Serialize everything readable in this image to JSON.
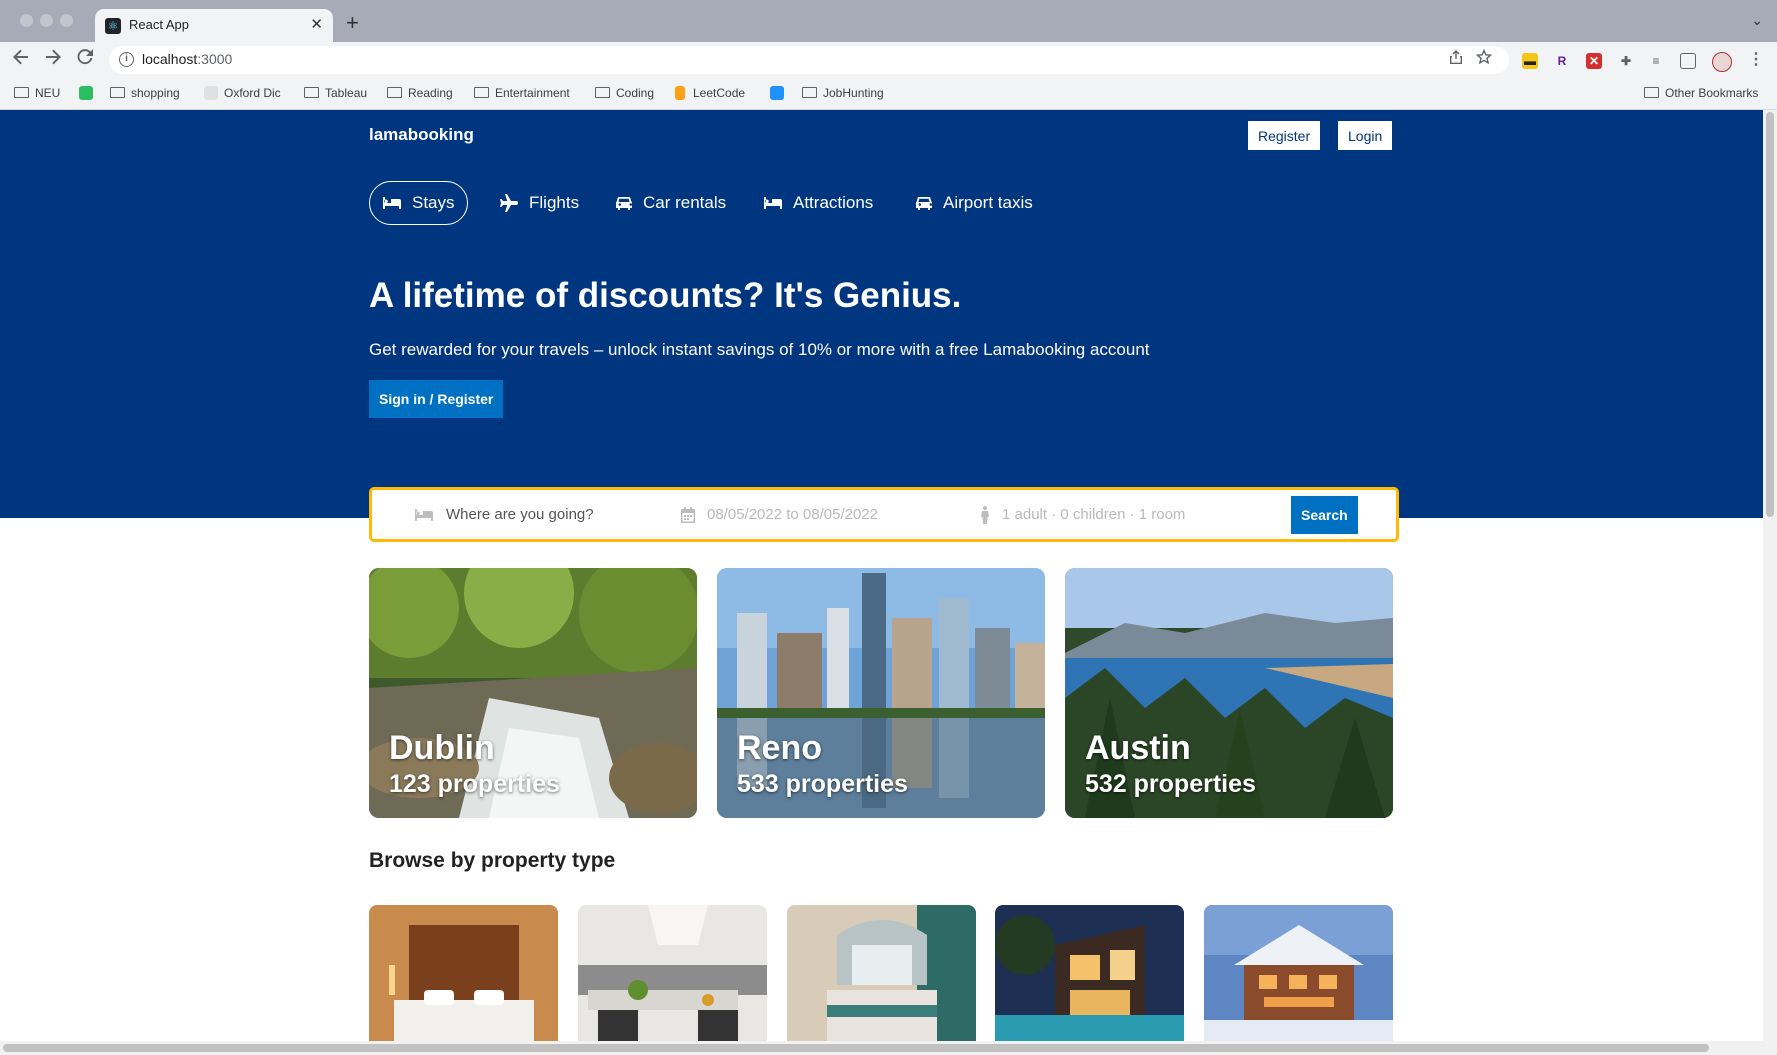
{
  "browser": {
    "tab_title": "React App",
    "tab_favicon": "⚛",
    "close_glyph": "✕",
    "newtab_glyph": "+",
    "menu_glyph": "⌄",
    "url_host": "localhost",
    "url_port": ":3000",
    "icons": [
      "back-icon",
      "forward-icon",
      "reload-icon",
      "info-icon",
      "share-icon",
      "star-icon",
      "extensions-icon",
      "reading-list-icon",
      "side-panel-icon",
      "profile-icon",
      "menu-icon"
    ],
    "bookmarks": [
      "NEU",
      "shopping",
      "Oxford Dic",
      "Tableau",
      "Reading",
      "Entertainment",
      "Coding",
      "LeetCode",
      "JobHunting"
    ],
    "other_bookmarks": "Other Bookmarks"
  },
  "header": {
    "logo": "lamabooking",
    "register": "Register",
    "login": "Login"
  },
  "nav": [
    {
      "label": "Stays",
      "icon": "bed-icon",
      "active": true
    },
    {
      "label": "Flights",
      "icon": "plane-icon",
      "active": false
    },
    {
      "label": "Car rentals",
      "icon": "car-icon",
      "active": false
    },
    {
      "label": "Attractions",
      "icon": "bed-icon",
      "active": false
    },
    {
      "label": "Airport taxis",
      "icon": "taxi-icon",
      "active": false
    }
  ],
  "hero": {
    "title": "A lifetime of discounts? It's Genius.",
    "subtitle": "Get rewarded for your travels – unlock instant savings of 10% or more with a free Lamabooking account",
    "cta": "Sign in / Register"
  },
  "search": {
    "destination_placeholder": "Where are you going?",
    "dates": "08/05/2022 to 08/05/2022",
    "guests": "1 adult · 0 children · 1 room",
    "button": "Search"
  },
  "featured": [
    {
      "name": "Dublin",
      "count": "123 properties"
    },
    {
      "name": "Reno",
      "count": "533 properties"
    },
    {
      "name": "Austin",
      "count": "532 properties"
    }
  ],
  "property_types_title": "Browse by property type",
  "colors": {
    "brand": "#003580",
    "accent": "#0071c2",
    "search_border": "#febb02"
  }
}
